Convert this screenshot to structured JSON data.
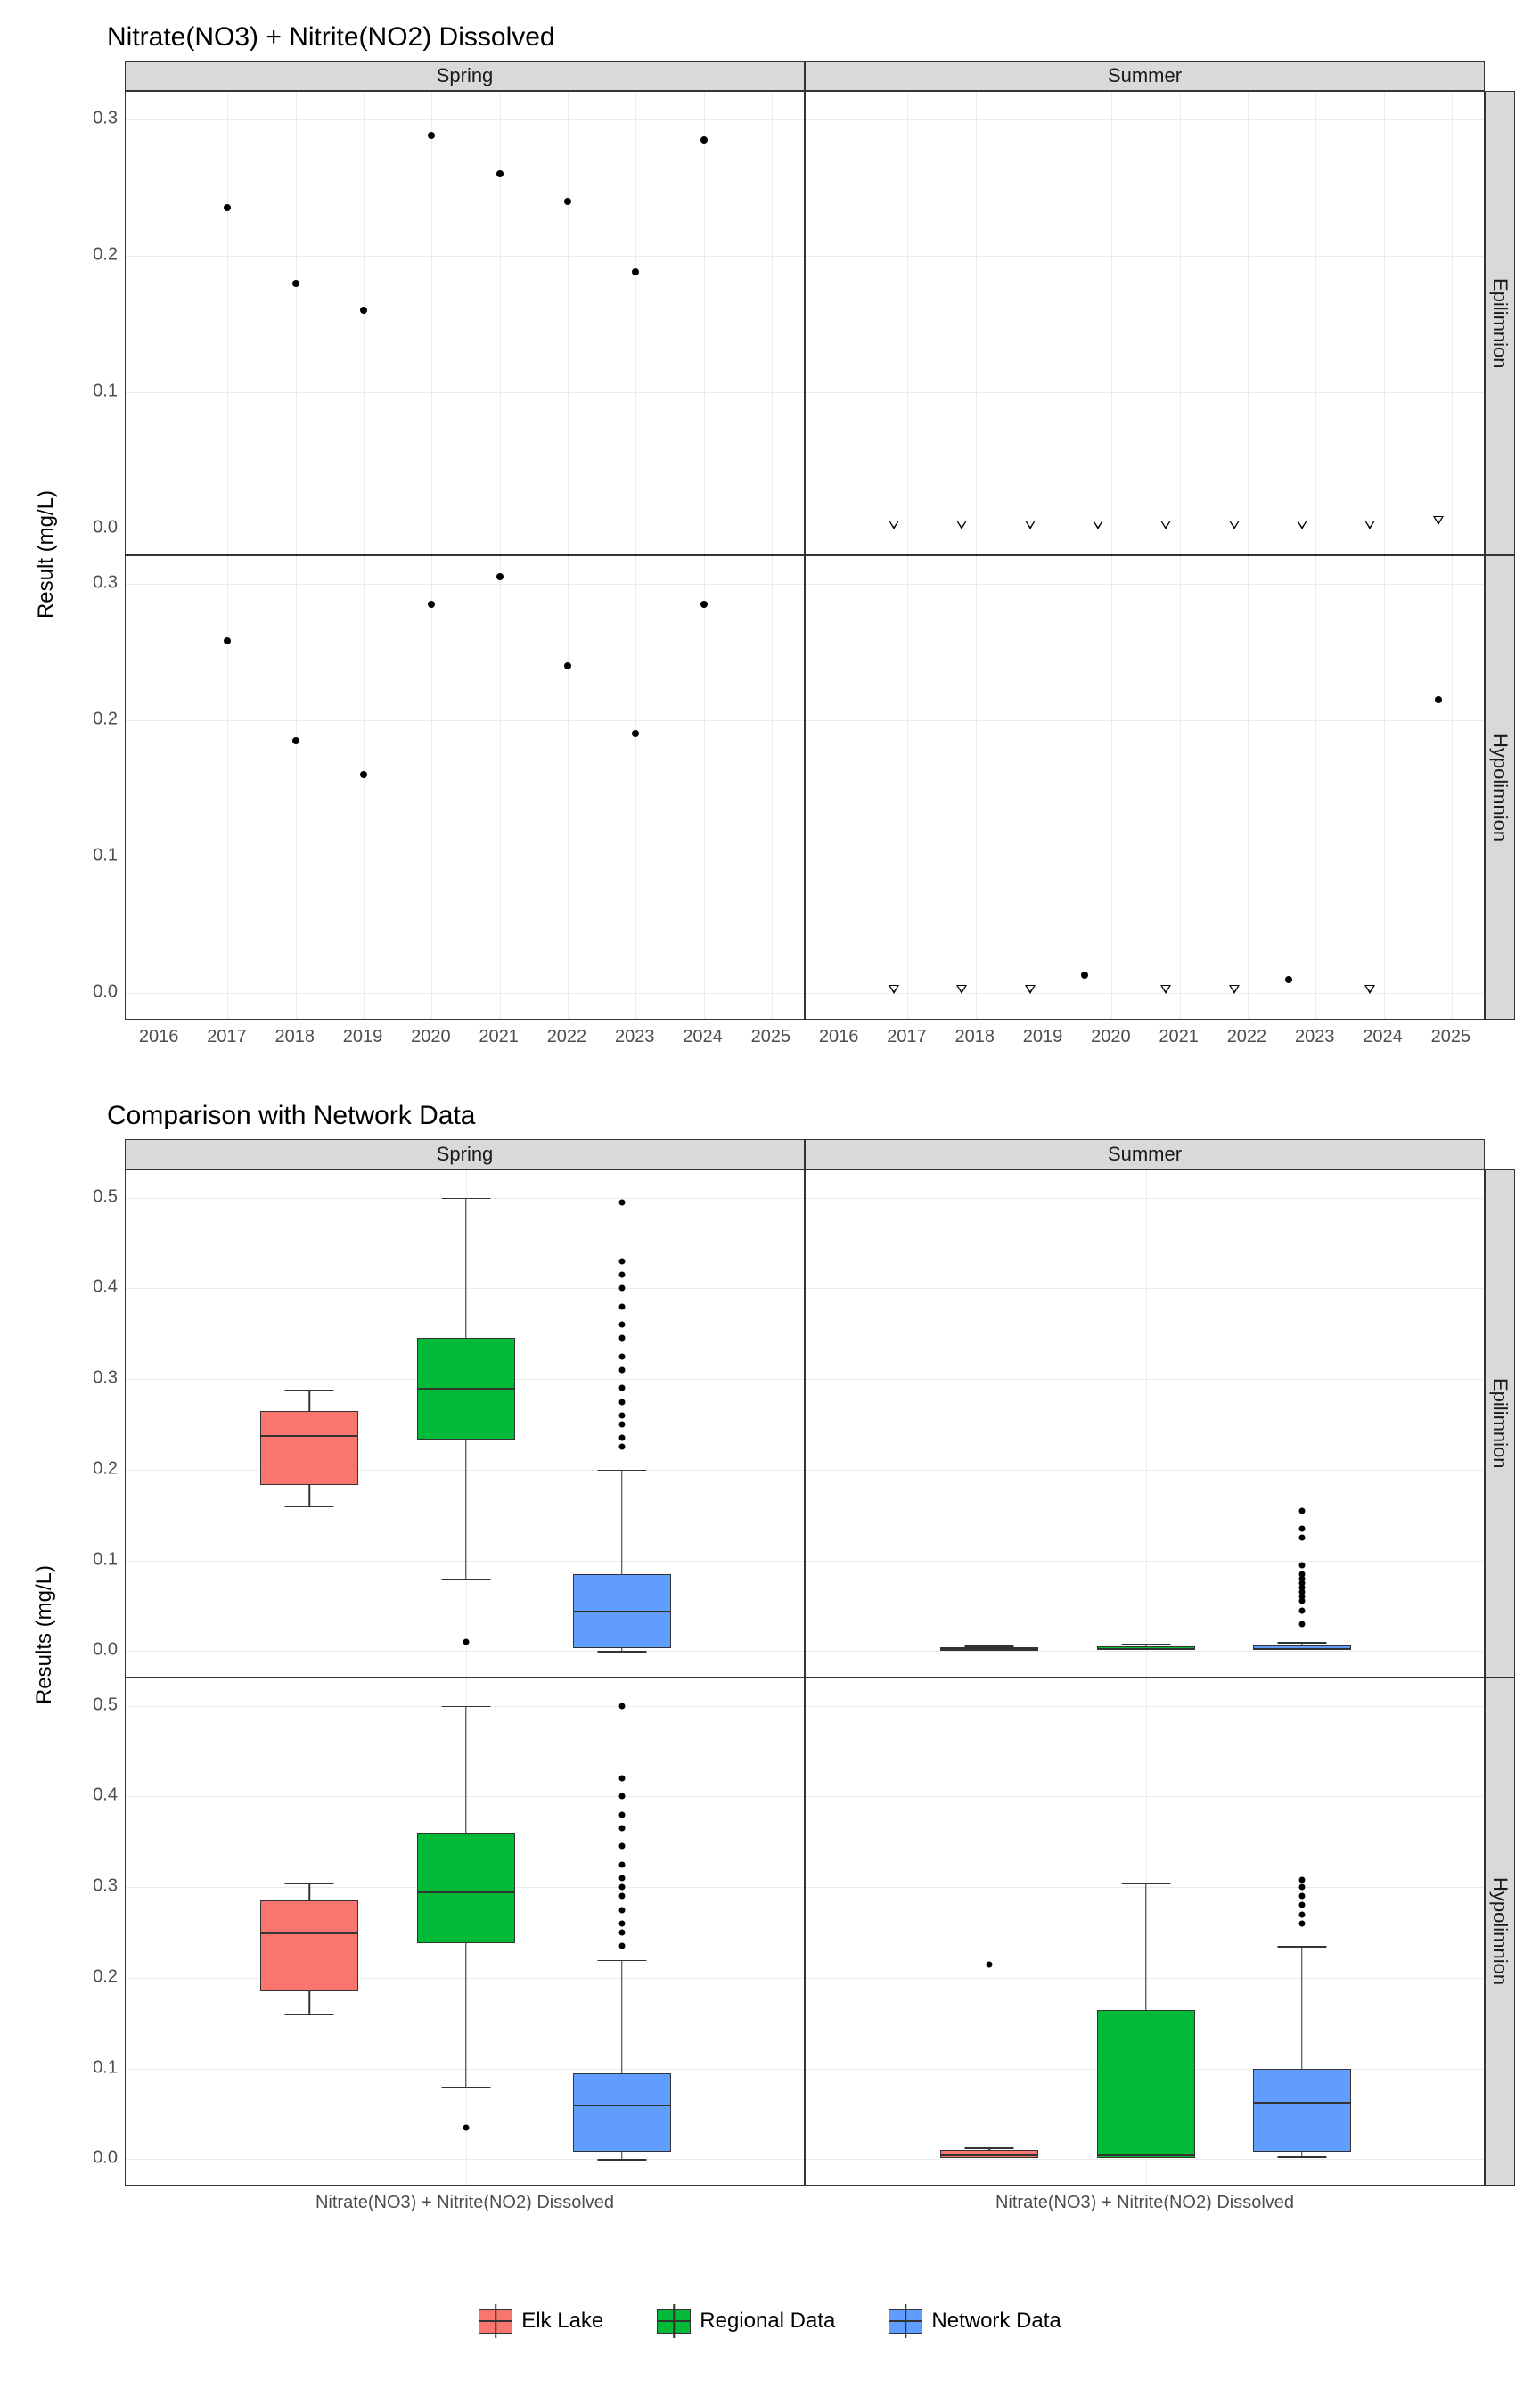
{
  "chart1": {
    "title": "Nitrate(NO3) + Nitrite(NO2) Dissolved",
    "ylabel": "Result (mg/L)",
    "col_facets": [
      "Spring",
      "Summer"
    ],
    "row_facets": [
      "Epilimnion",
      "Hypolimnion"
    ],
    "y_ticks": [
      0.0,
      0.1,
      0.2,
      0.3
    ],
    "y_range": [
      -0.02,
      0.32
    ],
    "x_ticks": [
      2016,
      2017,
      2018,
      2019,
      2020,
      2021,
      2022,
      2023,
      2024,
      2025
    ],
    "x_range": [
      2015.5,
      2025.5
    ]
  },
  "chart2": {
    "title": "Comparison with Network Data",
    "ylabel": "Results (mg/L)",
    "col_facets": [
      "Spring",
      "Summer"
    ],
    "row_facets": [
      "Epilimnion",
      "Hypolimnion"
    ],
    "y_ticks": [
      0.0,
      0.1,
      0.2,
      0.3,
      0.4,
      0.5
    ],
    "y_range": [
      -0.03,
      0.53
    ],
    "x_label": "Nitrate(NO3) + Nitrite(NO2) Dissolved",
    "legend": [
      {
        "label": "Elk Lake",
        "color": "#f8766d"
      },
      {
        "label": "Regional Data",
        "color": "#00ba38"
      },
      {
        "label": "Network Data",
        "color": "#619cff"
      }
    ]
  },
  "chart_data": [
    {
      "type": "scatter",
      "title": "Nitrate(NO3) + Nitrite(NO2) Dissolved",
      "facets": {
        "columns": [
          "Spring",
          "Summer"
        ],
        "rows": [
          "Epilimnion",
          "Hypolimnion"
        ]
      },
      "xlabel": "",
      "ylabel": "Result (mg/L)",
      "ylim": [
        0,
        0.32
      ],
      "panels": {
        "Spring_Epilimnion": {
          "x": [
            2017,
            2018,
            2019,
            2020,
            2021,
            2022,
            2023,
            2024
          ],
          "y": [
            0.235,
            0.18,
            0.16,
            0.288,
            0.26,
            0.24,
            0.188,
            0.285
          ],
          "shape": "filled"
        },
        "Summer_Epilimnion": {
          "x": [
            2016.8,
            2017.8,
            2018.8,
            2019.8,
            2020.8,
            2021.8,
            2022.8,
            2023.8,
            2024.8
          ],
          "y": [
            0.003,
            0.003,
            0.003,
            0.003,
            0.003,
            0.003,
            0.003,
            0.003,
            0.006
          ],
          "shape": "open"
        },
        "Spring_Hypolimnion": {
          "x": [
            2017,
            2018,
            2019,
            2020,
            2021,
            2022,
            2023,
            2024
          ],
          "y": [
            0.258,
            0.185,
            0.16,
            0.285,
            0.305,
            0.24,
            0.19,
            0.285
          ],
          "shape": "filled"
        },
        "Summer_Hypolimnion": {
          "x": [
            2016.8,
            2017.8,
            2018.8,
            2019.6,
            2020.8,
            2021.8,
            2022.6,
            2023.8,
            2024.8
          ],
          "y": [
            0.003,
            0.003,
            0.003,
            0.013,
            0.003,
            0.003,
            0.01,
            0.003,
            0.215
          ],
          "shape": "mixed",
          "filled_idx": [
            3,
            6,
            8
          ]
        }
      }
    },
    {
      "type": "box",
      "title": "Comparison with Network Data",
      "facets": {
        "columns": [
          "Spring",
          "Summer"
        ],
        "rows": [
          "Epilimnion",
          "Hypolimnion"
        ]
      },
      "ylabel": "Results (mg/L)",
      "ylim": [
        0,
        0.53
      ],
      "series_names": [
        "Elk Lake",
        "Regional Data",
        "Network Data"
      ],
      "colors": {
        "Elk Lake": "#f8766d",
        "Regional Data": "#00ba38",
        "Network Data": "#619cff"
      },
      "panels": {
        "Spring_Epilimnion": [
          {
            "name": "Elk Lake",
            "min": 0.16,
            "q1": 0.185,
            "median": 0.238,
            "q3": 0.265,
            "max": 0.288,
            "outliers": []
          },
          {
            "name": "Regional Data",
            "min": 0.08,
            "q1": 0.235,
            "median": 0.29,
            "q3": 0.345,
            "max": 0.5,
            "outliers": [
              0.01
            ]
          },
          {
            "name": "Network Data",
            "min": 0.0,
            "q1": 0.005,
            "median": 0.045,
            "q3": 0.085,
            "max": 0.2,
            "outliers": [
              0.225,
              0.235,
              0.25,
              0.26,
              0.275,
              0.29,
              0.31,
              0.325,
              0.345,
              0.36,
              0.38,
              0.4,
              0.415,
              0.43,
              0.495
            ]
          }
        ],
        "Summer_Epilimnion": [
          {
            "name": "Elk Lake",
            "min": 0.003,
            "q1": 0.003,
            "median": 0.003,
            "q3": 0.004,
            "max": 0.006,
            "outliers": []
          },
          {
            "name": "Regional Data",
            "min": 0.003,
            "q1": 0.003,
            "median": 0.003,
            "q3": 0.005,
            "max": 0.008,
            "outliers": []
          },
          {
            "name": "Network Data",
            "min": 0.003,
            "q1": 0.003,
            "median": 0.003,
            "q3": 0.006,
            "max": 0.01,
            "outliers": [
              0.03,
              0.045,
              0.055,
              0.06,
              0.065,
              0.07,
              0.075,
              0.08,
              0.085,
              0.095,
              0.125,
              0.135,
              0.155
            ]
          }
        ],
        "Spring_Hypolimnion": [
          {
            "name": "Elk Lake",
            "min": 0.16,
            "q1": 0.187,
            "median": 0.25,
            "q3": 0.285,
            "max": 0.305,
            "outliers": []
          },
          {
            "name": "Regional Data",
            "min": 0.08,
            "q1": 0.24,
            "median": 0.295,
            "q3": 0.36,
            "max": 0.5,
            "outliers": [
              0.035
            ]
          },
          {
            "name": "Network Data",
            "min": 0.0,
            "q1": 0.01,
            "median": 0.06,
            "q3": 0.095,
            "max": 0.22,
            "outliers": [
              0.235,
              0.25,
              0.26,
              0.275,
              0.29,
              0.3,
              0.31,
              0.325,
              0.345,
              0.365,
              0.38,
              0.4,
              0.42,
              0.5
            ]
          }
        ],
        "Summer_Hypolimnion": [
          {
            "name": "Elk Lake",
            "min": 0.003,
            "q1": 0.003,
            "median": 0.005,
            "q3": 0.01,
            "max": 0.013,
            "outliers": [
              0.215
            ]
          },
          {
            "name": "Regional Data",
            "min": 0.003,
            "q1": 0.003,
            "median": 0.005,
            "q3": 0.165,
            "max": 0.305,
            "outliers": []
          },
          {
            "name": "Network Data",
            "min": 0.003,
            "q1": 0.01,
            "median": 0.063,
            "q3": 0.1,
            "max": 0.235,
            "outliers": [
              0.26,
              0.27,
              0.28,
              0.29,
              0.3,
              0.308
            ]
          }
        ]
      }
    }
  ]
}
